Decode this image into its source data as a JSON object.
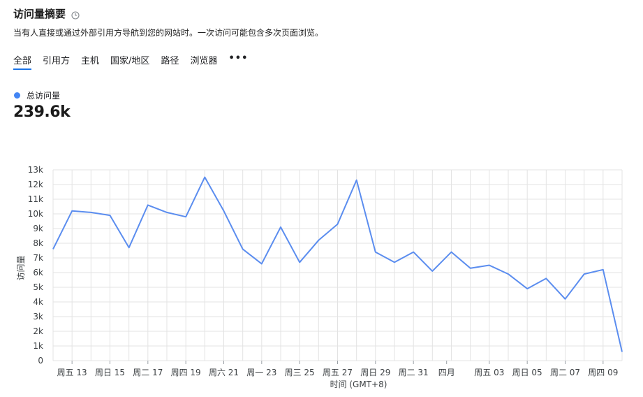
{
  "header": {
    "title": "访问量摘要",
    "subtitle": "当有人直接或通过外部引用方导航到您的网站时。一次访问可能包含多次页面浏览。"
  },
  "tabs": [
    {
      "label": "全部",
      "active": true
    },
    {
      "label": "引用方",
      "active": false
    },
    {
      "label": "主机",
      "active": false
    },
    {
      "label": "国家/地区",
      "active": false
    },
    {
      "label": "路径",
      "active": false
    },
    {
      "label": "浏览器",
      "active": false
    }
  ],
  "tab_more": "•••",
  "metric": {
    "label": "总访问量",
    "value": "239.6k"
  },
  "colors": {
    "series": "#5b8def",
    "grid": "#e3e3e3",
    "tab_underline": "#1a73e8"
  },
  "chart_data": {
    "type": "line",
    "xlabel": "时间 (GMT+8)",
    "ylabel": "访问量",
    "ylim": [
      0,
      13000
    ],
    "grid": true,
    "legend": "none",
    "ytick_labels": [
      "0",
      "1k",
      "2k",
      "3k",
      "4k",
      "5k",
      "6k",
      "7k",
      "8k",
      "9k",
      "10k",
      "11k",
      "12k",
      "13k"
    ],
    "xtick_labels": [
      "周五 13",
      "周日 15",
      "周二 17",
      "周四 19",
      "周六 21",
      "周一 23",
      "周三 25",
      "周五 27",
      "周日 29",
      "周二 31",
      "四月",
      "周五 03",
      "周日 05",
      "周二 07",
      "周四 09"
    ],
    "series": [
      {
        "values": [
          7600,
          10200,
          10100,
          9900,
          7700,
          10600,
          10100,
          9800,
          12500,
          10200,
          7600,
          6600,
          9100,
          6700,
          8200,
          9300,
          12300,
          7400,
          6700,
          7400,
          6100,
          7400,
          6300,
          6500,
          5900,
          4900,
          5600,
          4200,
          5900,
          6200,
          600
        ]
      }
    ]
  }
}
